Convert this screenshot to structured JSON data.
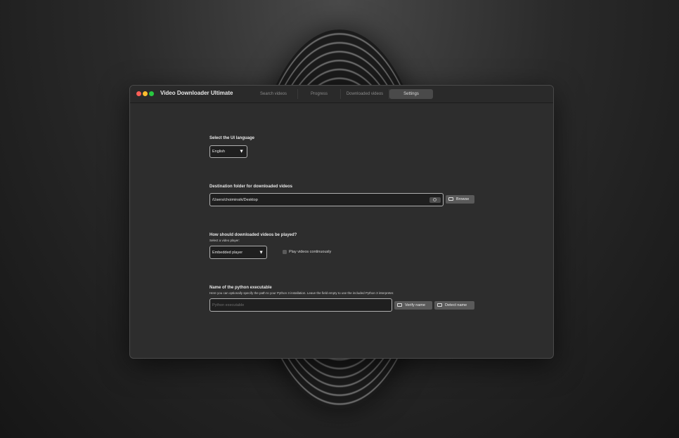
{
  "window": {
    "title": "Video Downloader Ultimate"
  },
  "tabs": [
    {
      "label": "Search videos",
      "active": false
    },
    {
      "label": "Progress",
      "active": false
    },
    {
      "label": "Downloaded videos",
      "active": false
    },
    {
      "label": "Settings",
      "active": true
    }
  ],
  "settings": {
    "language": {
      "label": "Select the UI language",
      "selected": "English"
    },
    "destination": {
      "label": "Destination folder for downloaded videos",
      "value": "/Users/choiminsik/Desktop",
      "browse_label": "Browse"
    },
    "player": {
      "label": "How should downloaded videos be played?",
      "sublabel": "Select a video player:",
      "selected": "Embedded player",
      "continuous_label": "Play videos continuously",
      "continuous_checked": false
    },
    "python": {
      "label": "Name of the python executable",
      "sublabel": "Here you can optionally specify the path to your Python 3 installation. Leave the field empty to use the included Python 3 interpreter.",
      "placeholder": "Python executable",
      "verify_label": "Verify name",
      "detect_label": "Detect name"
    }
  },
  "colors": {
    "window_bg": "#2d2d2d",
    "traffic_close": "#ff5f57",
    "traffic_min": "#febc2e",
    "traffic_max": "#28c840"
  },
  "icons": {
    "select_caret": "▼"
  }
}
